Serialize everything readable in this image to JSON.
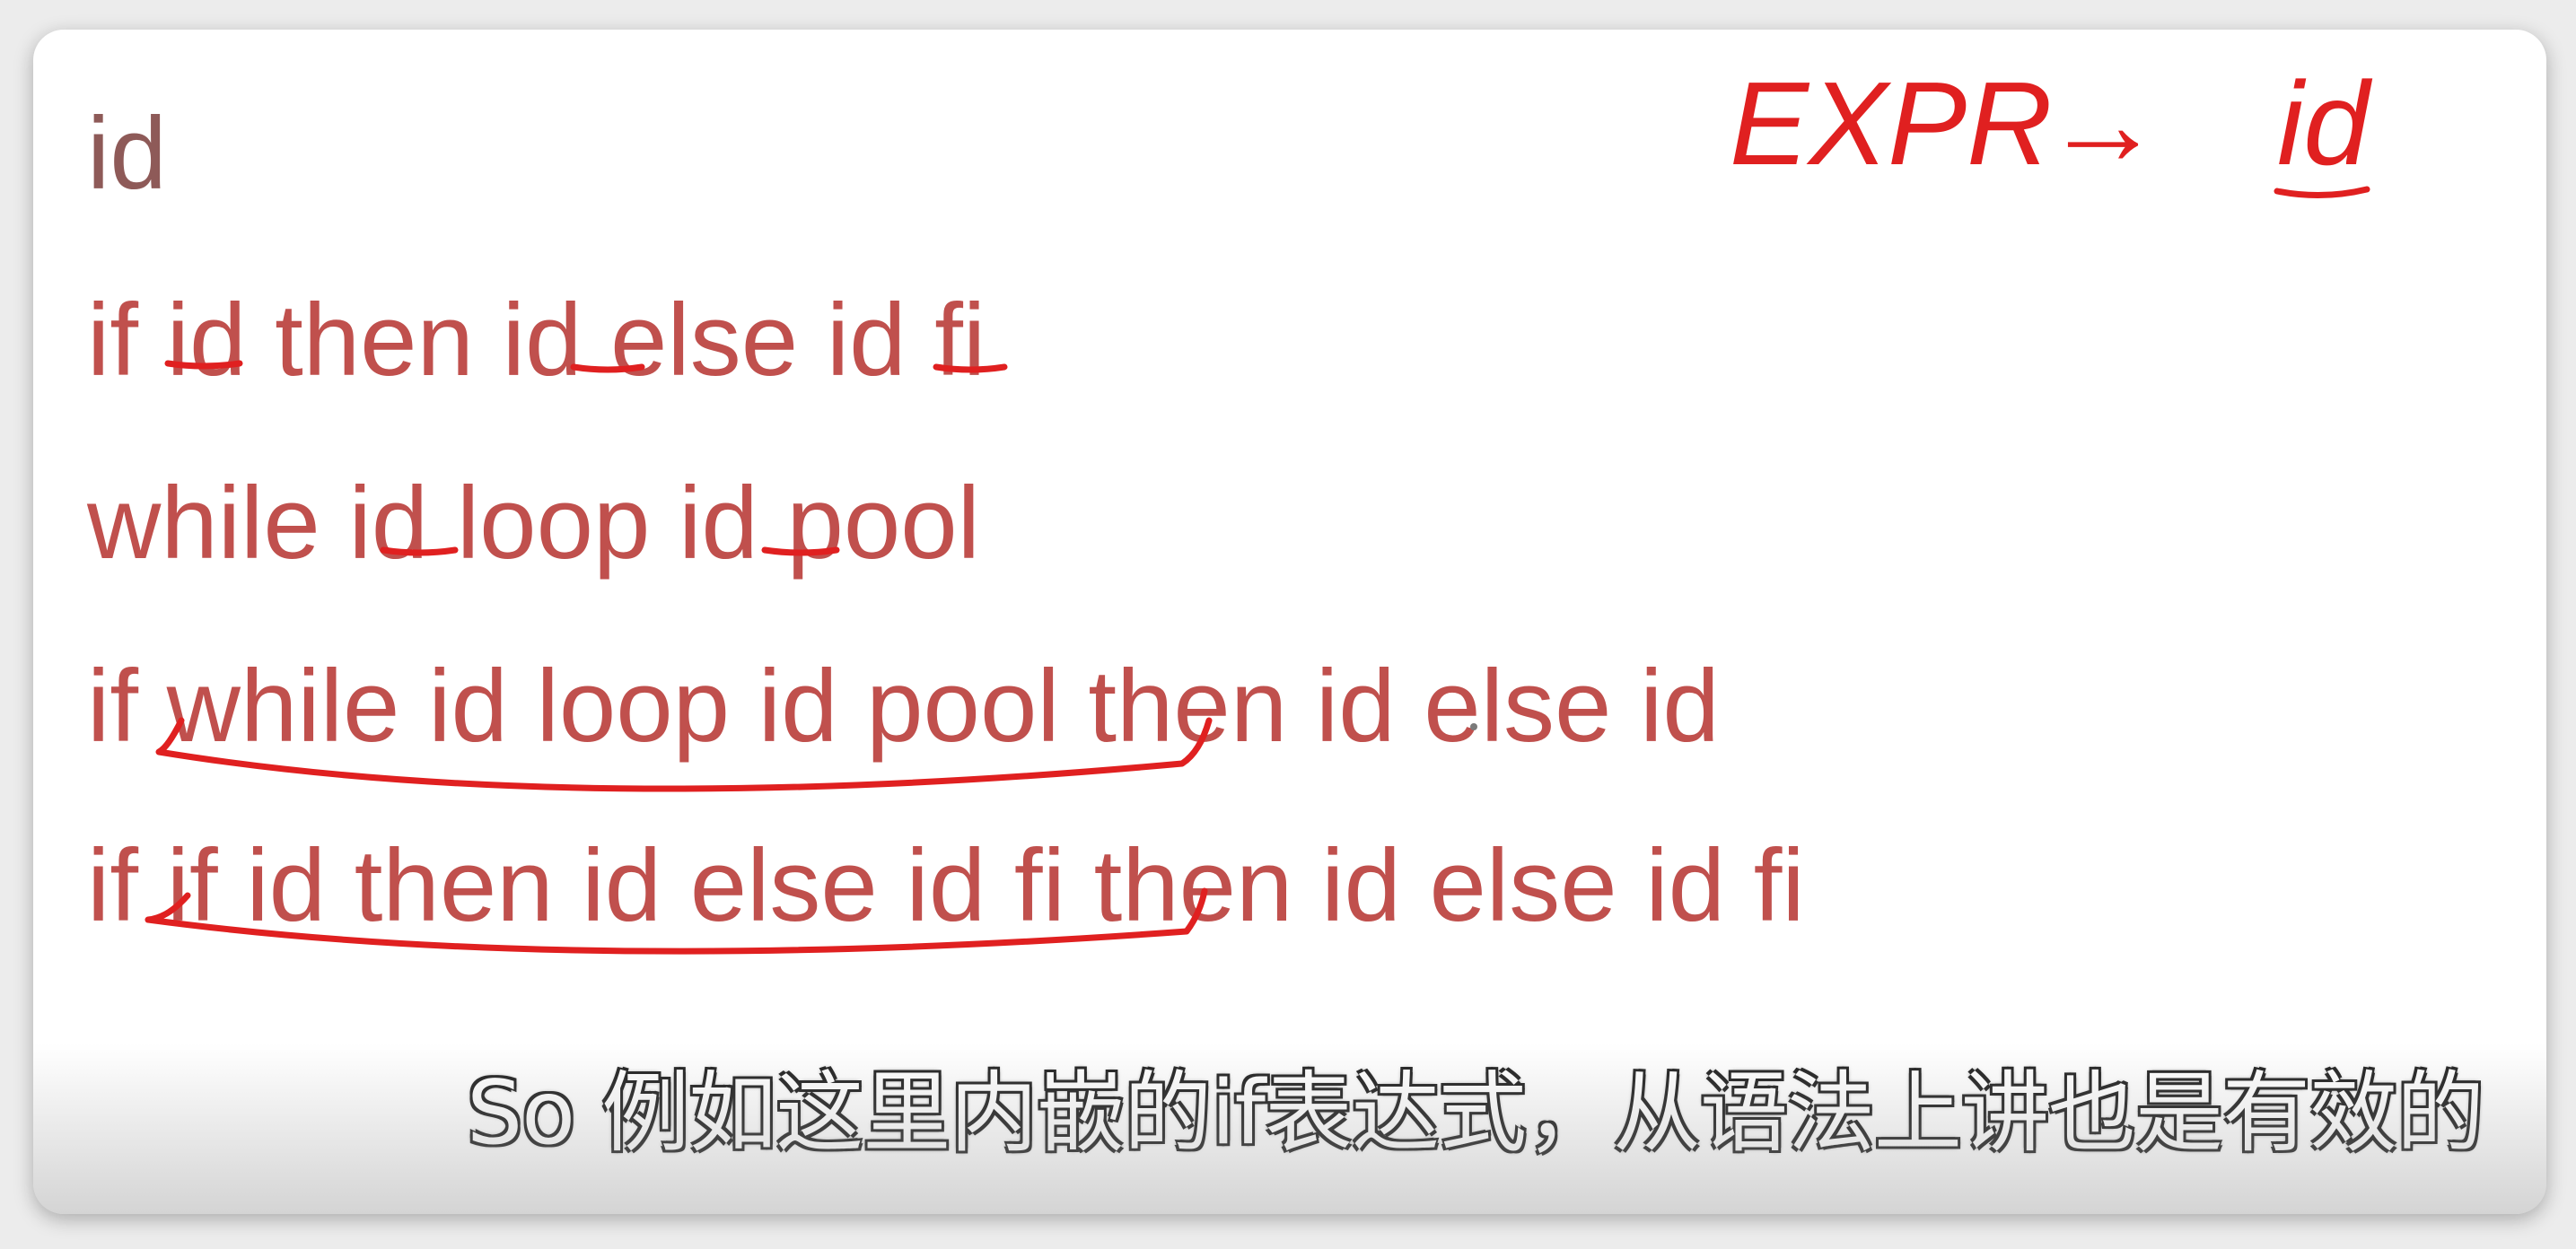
{
  "slide": {
    "lines": [
      "id",
      "if id then id else id fi",
      "while id loop id pool",
      "if while id loop id pool then id else id",
      "if if id then id else id fi then id else id fi"
    ],
    "text_color": "#c0504d"
  },
  "annotation": {
    "rule_lhs": "EXPR",
    "rule_arrow": "→",
    "rule_rhs": "id",
    "ink_color": "#e02020"
  },
  "subtitle": {
    "text": "So 例如这里内嵌的if表达式，从语法上讲也是有效的"
  }
}
